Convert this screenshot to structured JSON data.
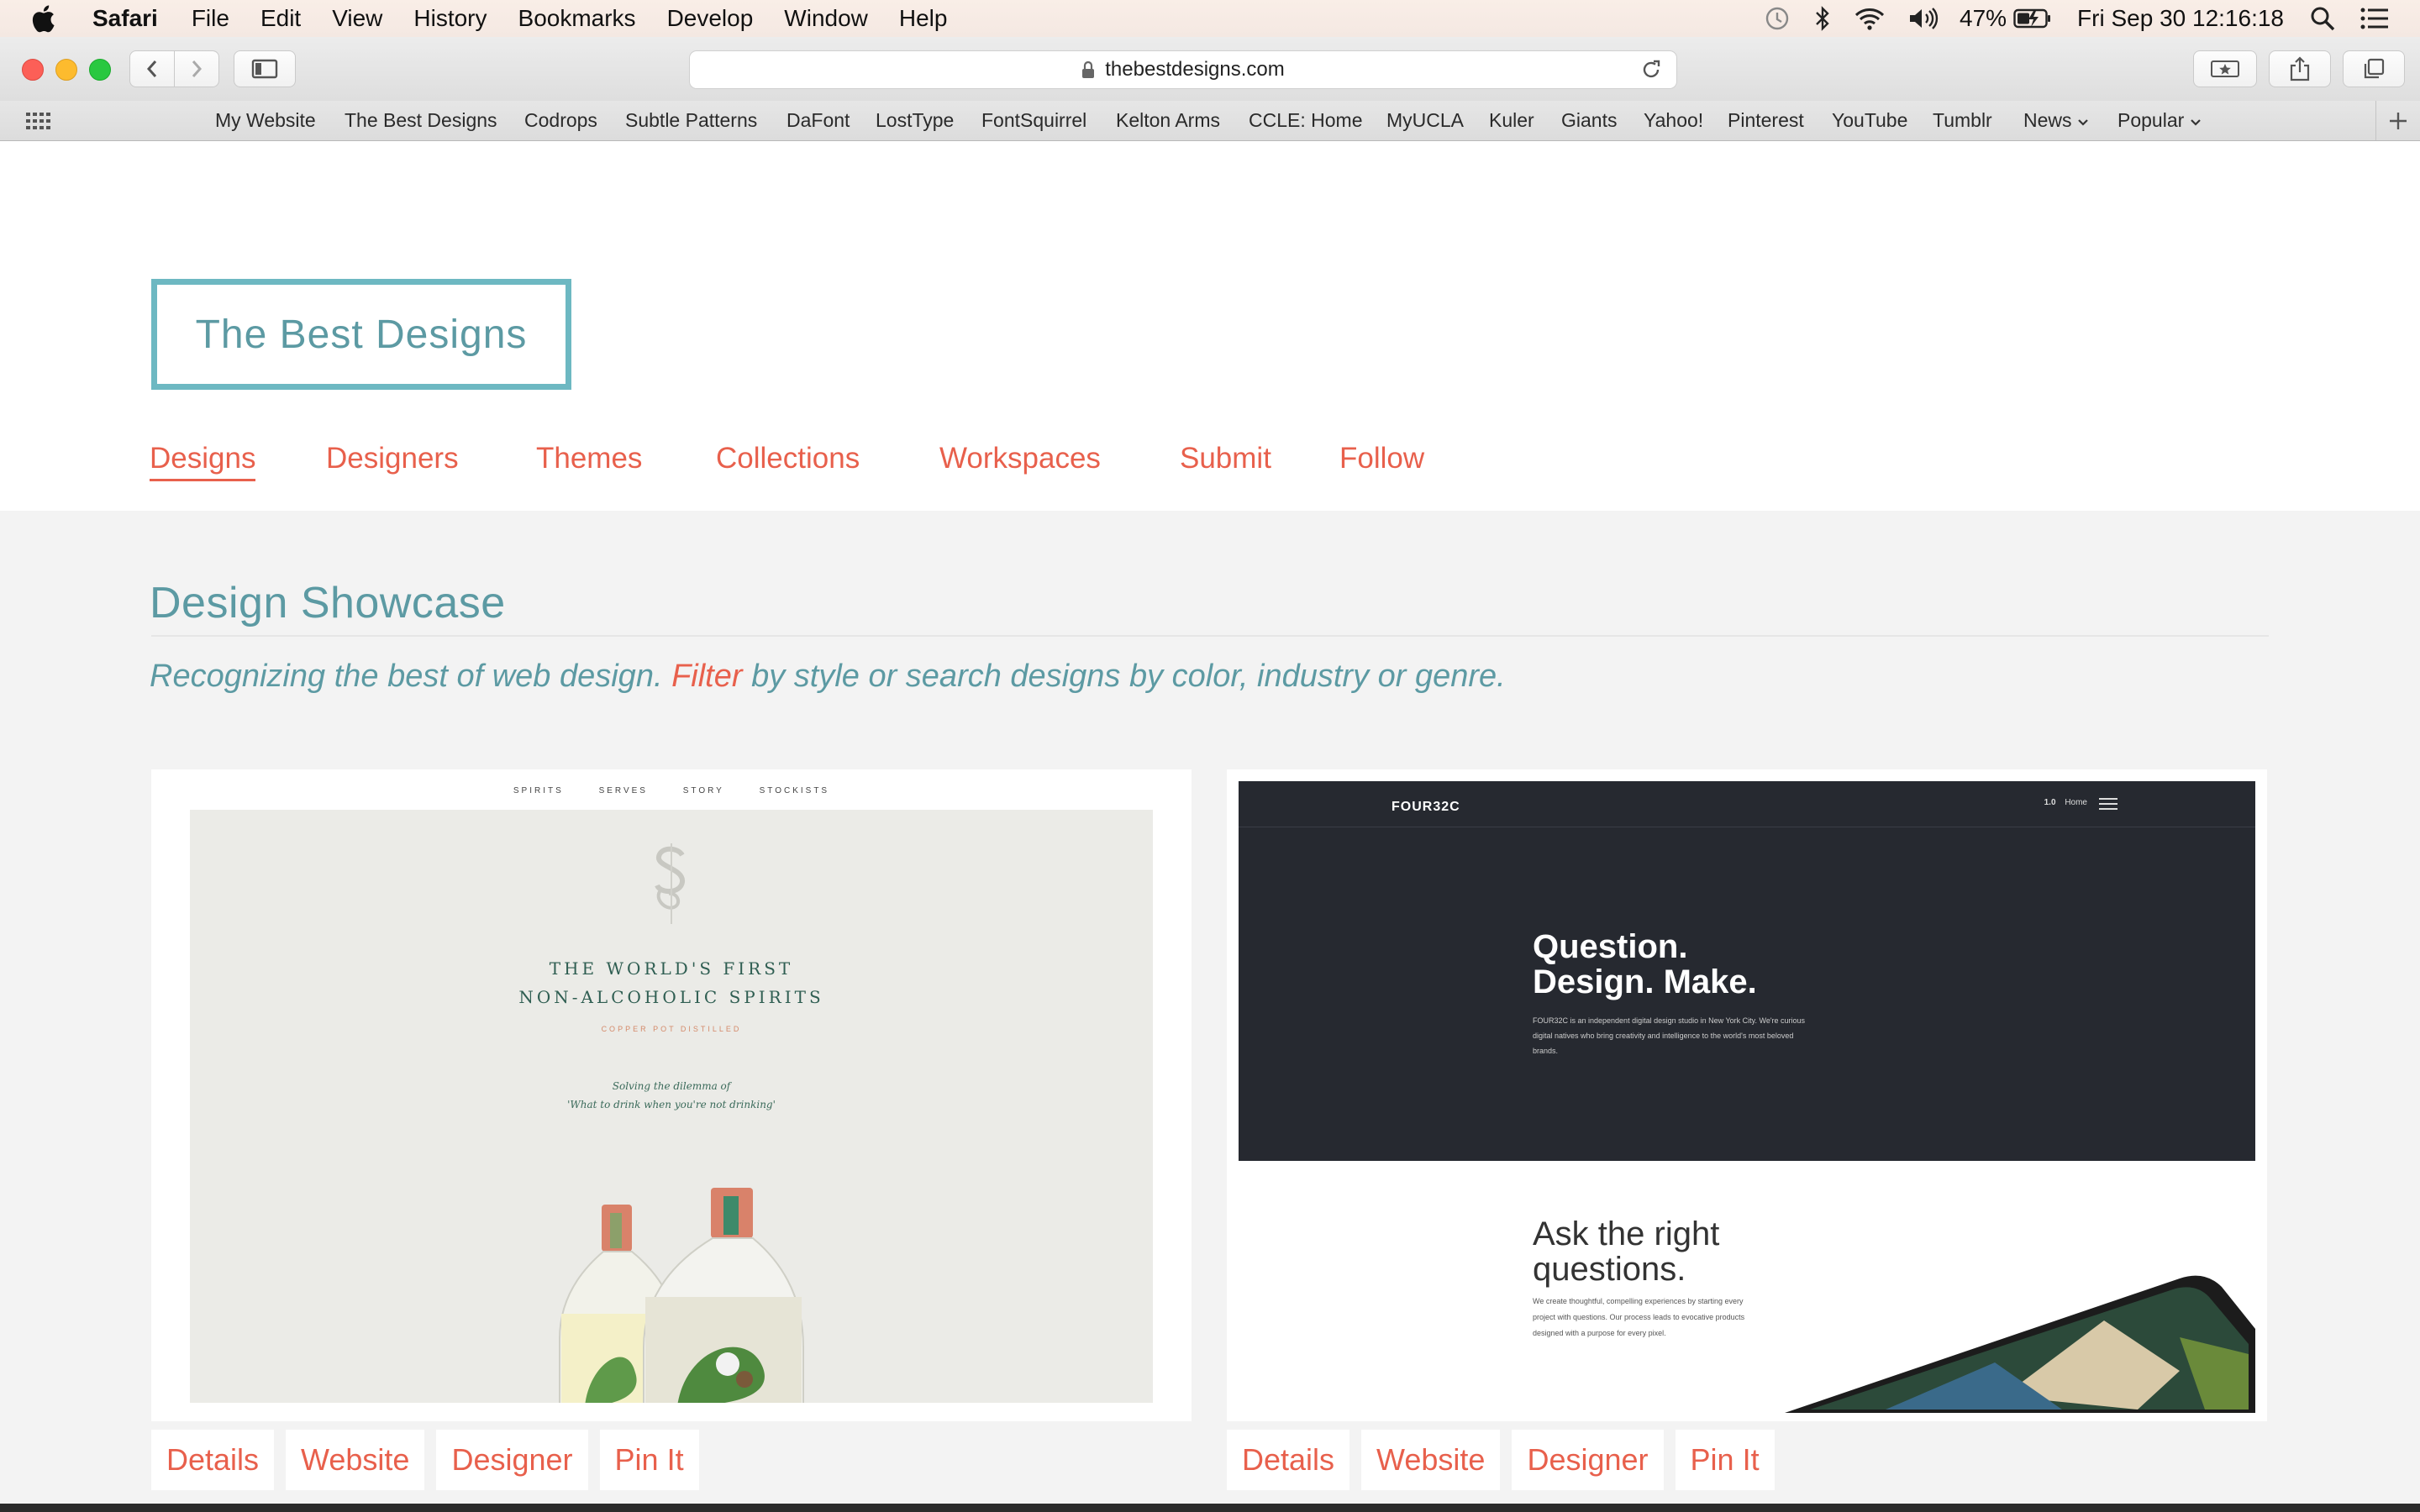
{
  "menubar": {
    "app_name": "Safari",
    "items": [
      "File",
      "Edit",
      "View",
      "History",
      "Bookmarks",
      "Develop",
      "Window",
      "Help"
    ],
    "battery": "47%",
    "datetime": "Fri Sep 30  12:16:18",
    "icons": [
      "apple-icon",
      "time-machine-icon",
      "bluetooth-icon",
      "wifi-icon",
      "volume-icon",
      "battery-icon",
      "spotlight-icon",
      "notification-center-icon"
    ]
  },
  "toolbar": {
    "url": "thebestdesigns.com"
  },
  "bookmarks": {
    "items": [
      "My Website",
      "The Best Designs",
      "Codrops",
      "Subtle Patterns",
      "DaFont",
      "LostType",
      "FontSquirrel",
      "Kelton Arms",
      "CCLE: Home",
      "MyUCLA",
      "Kuler",
      "Giants",
      "Yahoo!",
      "Pinterest",
      "YouTube",
      "Tumblr"
    ],
    "folders": [
      "News",
      "Popular"
    ]
  },
  "site": {
    "logo": "The Best Designs",
    "nav": [
      "Designs",
      "Designers",
      "Themes",
      "Collections",
      "Workspaces",
      "Submit",
      "Follow"
    ],
    "active_nav": "Designs",
    "heading": "Design Showcase",
    "tagline_before": "Recognizing the best of web design. ",
    "tagline_link": "Filter",
    "tagline_after": " by style or search designs by color, industry or genre.",
    "accent_color": "#e8604c",
    "teal_color": "#5c9aa3"
  },
  "cards": [
    {
      "topnav": [
        "SPIRITS",
        "SERVES",
        "STORY",
        "STOCKISTS"
      ],
      "headline_1": "THE WORLD'S FIRST",
      "headline_2": "NON-ALCOHOLIC SPIRITS",
      "distillery": "COPPER POT DISTILLED",
      "subtitle_1": "Solving the dilemma of",
      "subtitle_2": "'What to drink when you're not drinking'",
      "actions": [
        "Details",
        "Website",
        "Designer",
        "Pin It"
      ]
    },
    {
      "brand": "FOUR32C",
      "nav_num": "1.0",
      "nav_label": "Home",
      "headline_1": "Question.",
      "headline_2": "Design. Make.",
      "intro": "FOUR32C is an independent digital design studio in New York City. We're curious digital natives who bring creativity and intelligence to the world's most beloved brands.",
      "ask_1": "Ask the right",
      "ask_2": "questions.",
      "ask_text": "We create thoughtful, compelling experiences by starting every project with questions. Our process leads to evocative products designed with a purpose for every pixel.",
      "actions": [
        "Details",
        "Website",
        "Designer",
        "Pin It"
      ]
    }
  ]
}
